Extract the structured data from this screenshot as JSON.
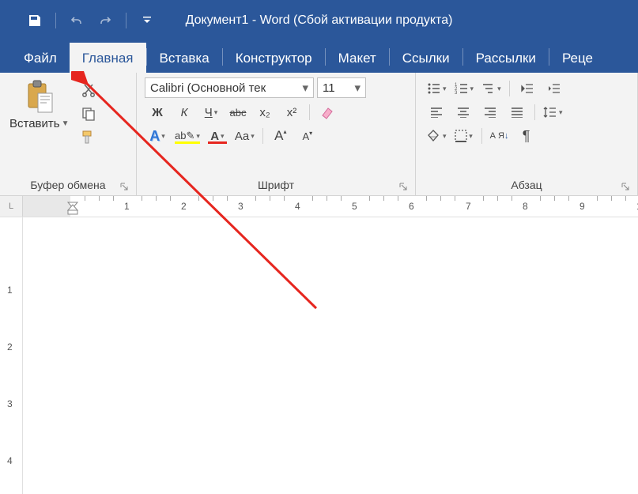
{
  "title": "Документ1  -  Word (Сбой активации продукта)",
  "tabs": [
    "Файл",
    "Главная",
    "Вставка",
    "Конструктор",
    "Макет",
    "Ссылки",
    "Рассылки",
    "Реце"
  ],
  "active_tab": 1,
  "clipboard": {
    "paste": "Вставить",
    "group": "Буфер обмена"
  },
  "font": {
    "name": "Calibri (Основной тек",
    "size": "11",
    "bold": "Ж",
    "italic": "К",
    "underline": "Ч",
    "strike": "abc",
    "sub": "x₂",
    "sup": "x²",
    "case": "Aa",
    "grow": "A",
    "shrink": "A",
    "group": "Шрифт"
  },
  "para": {
    "group": "Абзац",
    "sort": "А Я",
    "pilcrow": "¶"
  },
  "ruler": {
    "corner": "L"
  }
}
